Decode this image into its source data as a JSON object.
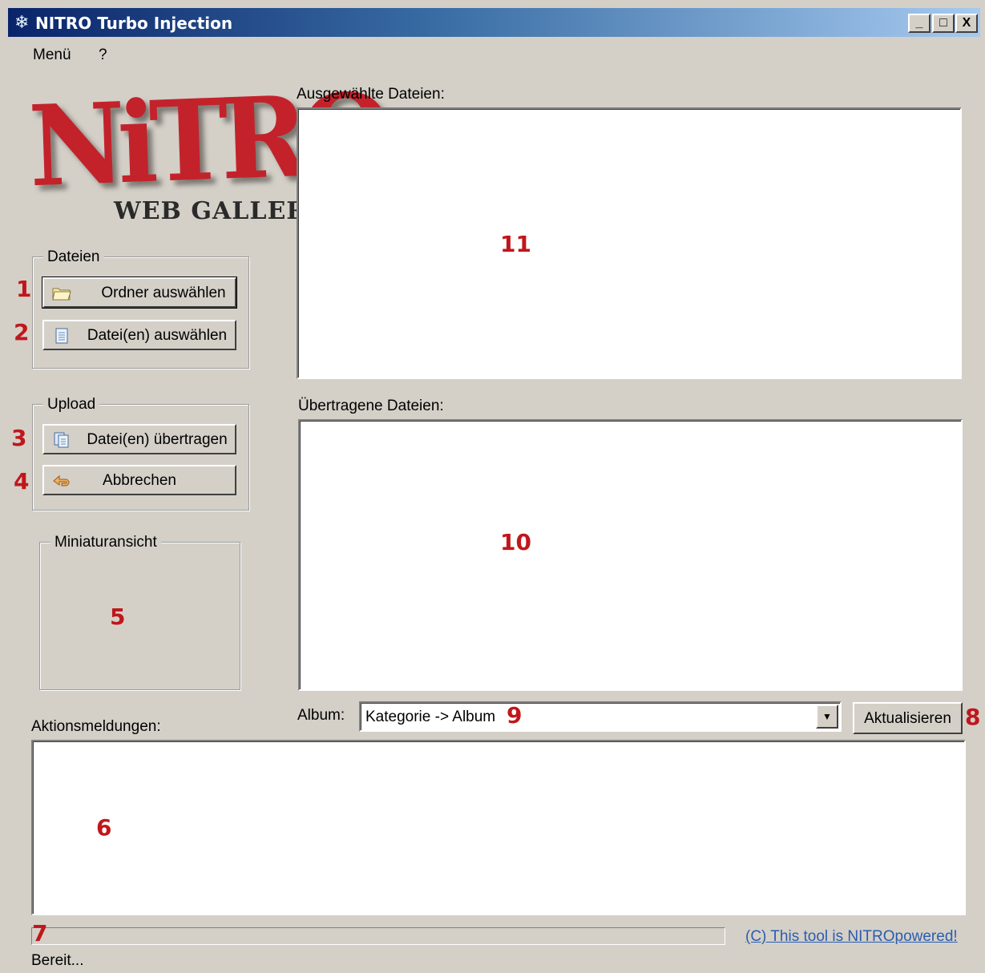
{
  "window": {
    "title": "NITRO Turbo Injection",
    "controls": {
      "minimize": "_",
      "maximize": "□",
      "close": "X"
    }
  },
  "menu": {
    "items": [
      "Menü",
      "?"
    ]
  },
  "logo": {
    "main": "NiTRO",
    "sub": "WEB GALLERY"
  },
  "dateien": {
    "label": "Dateien",
    "ordner_button": "Ordner auswählen",
    "dateien_button": "Datei(en) auswählen"
  },
  "upload": {
    "label": "Upload",
    "transfer_button": "Datei(en) übertragen",
    "cancel_button": "Abbrechen"
  },
  "preview": {
    "label": "Miniaturansicht"
  },
  "selected_files": {
    "label": "Ausgewählte Dateien:"
  },
  "transferred_files": {
    "label": "Übertragene Dateien:"
  },
  "album": {
    "label": "Album:",
    "value": "Kategorie -> Album",
    "refresh_button": "Aktualisieren"
  },
  "messages": {
    "label": "Aktionsmeldungen:"
  },
  "footer": {
    "status": "Bereit...",
    "link": "(C) This tool is NITROpowered!",
    "progress": 0
  },
  "annotations": [
    "1",
    "2",
    "3",
    "4",
    "5",
    "6",
    "7",
    "8",
    "9",
    "10",
    "11"
  ],
  "colors": {
    "annotation": "#c0171c",
    "logo_red": "#c3222b",
    "titlebar_start": "#0a246a",
    "titlebar_end": "#a6caf0",
    "window_bg": "#d4d0c8"
  }
}
